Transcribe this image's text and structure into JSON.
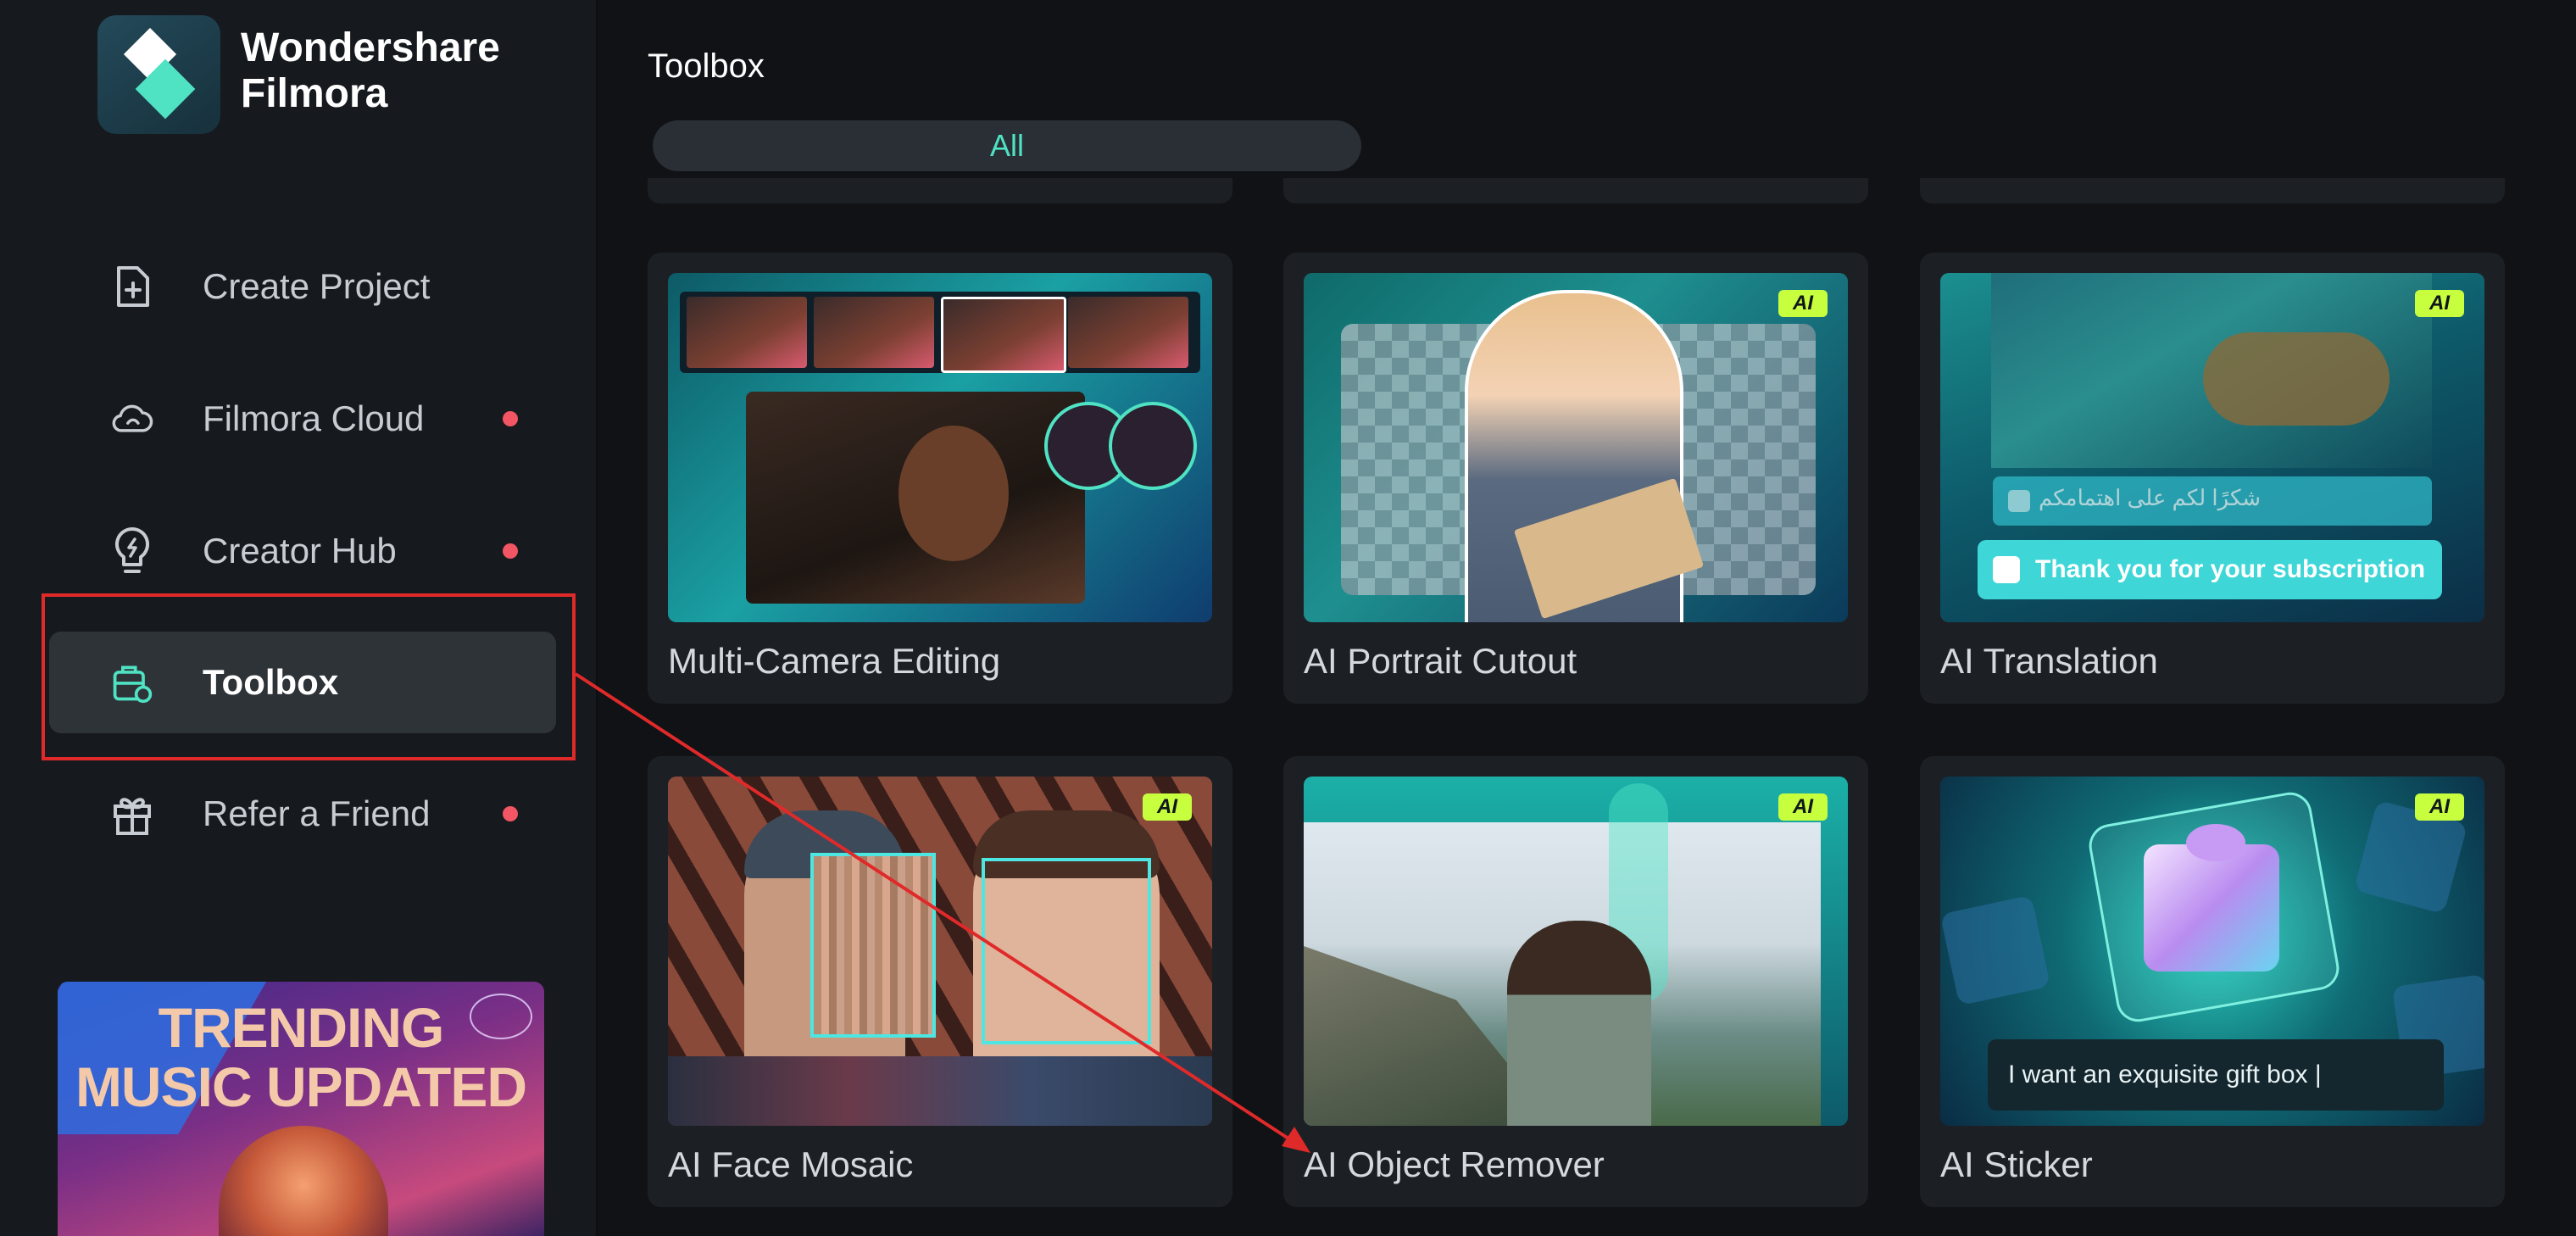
{
  "app": {
    "brand_line1": "Wondershare",
    "brand_line2": "Filmora"
  },
  "sidebar": {
    "items": [
      {
        "label": "Create Project",
        "icon": "file-plus-icon",
        "dot": false
      },
      {
        "label": "Filmora Cloud",
        "icon": "cloud-icon",
        "dot": true
      },
      {
        "label": "Creator Hub",
        "icon": "bulb-icon",
        "dot": true
      },
      {
        "label": "Toolbox",
        "icon": "toolbox-icon",
        "dot": false,
        "active": true
      },
      {
        "label": "Refer a Friend",
        "icon": "gift-icon",
        "dot": true
      }
    ],
    "promo": {
      "line1": "TRENDING",
      "line2": "MUSIC UPDATED"
    }
  },
  "main": {
    "title": "Toolbox",
    "filter_tab": "All",
    "cards": [
      {
        "label": "Multi-Camera Editing",
        "ai": false
      },
      {
        "label": "AI Portrait Cutout",
        "ai": true,
        "badge": "AI"
      },
      {
        "label": "AI Translation",
        "ai": true,
        "badge": "AI",
        "subtitle_ar": "شكرًا لكم على اهتمامكم",
        "subtitle_en": "Thank you for your subscription"
      },
      {
        "label": "AI Face Mosaic",
        "ai": true,
        "badge": "AI"
      },
      {
        "label": "AI Object Remover",
        "ai": true,
        "badge": "AI"
      },
      {
        "label": "AI Sticker",
        "ai": true,
        "badge": "AI",
        "prompt": "I want an exquisite gift box |"
      }
    ]
  },
  "colors": {
    "accent": "#4fe2c3",
    "notification_dot": "#f25563",
    "ai_badge": "#c7ff3f",
    "annotation_red": "#e02a2a"
  }
}
